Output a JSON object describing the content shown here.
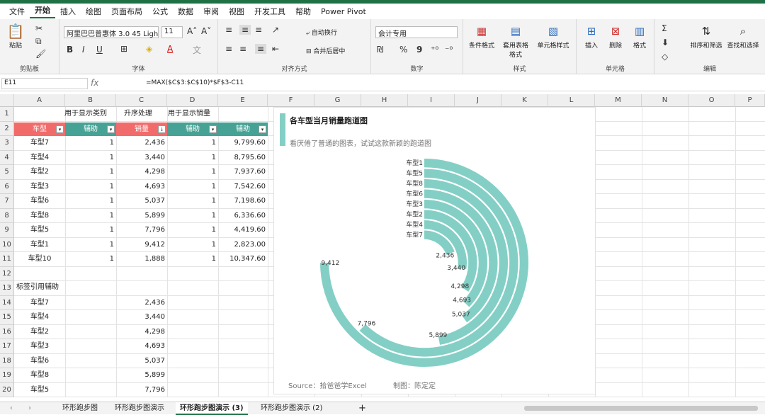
{
  "menu": [
    "文件",
    "开始",
    "插入",
    "绘图",
    "页面布局",
    "公式",
    "数据",
    "审阅",
    "视图",
    "开发工具",
    "帮助",
    "Power Pivot"
  ],
  "ribbon": {
    "clipboard": {
      "label": "剪贴板",
      "paste": "粘贴"
    },
    "font": {
      "label": "字体",
      "font_name": "阿里巴巴普惠体 3.0 45 Light",
      "font_size": "11",
      "bold": "B",
      "italic": "I",
      "underline": "U"
    },
    "align": {
      "label": "对齐方式",
      "wrap": "自动换行",
      "merge": "合并后居中"
    },
    "number": {
      "label": "数字",
      "format": "会计专用",
      "percent": "%",
      "comma": "9"
    },
    "styles": {
      "label": "样式",
      "cond": "条件格式",
      "table": "套用表格格式",
      "cell": "单元格样式"
    },
    "cells": {
      "label": "单元格",
      "insert": "插入",
      "delete": "删除",
      "format": "格式"
    },
    "edit": {
      "label": "编辑",
      "sort": "排序和筛选",
      "find": "查找和选择"
    }
  },
  "formula_bar": {
    "name_box": "E11",
    "fx": "fx",
    "formula": "=MAX($C$3:$C$10)*$F$3-C11"
  },
  "columns": [
    "A",
    "B",
    "C",
    "D",
    "E",
    "F",
    "G",
    "H",
    "I",
    "J",
    "K",
    "L",
    "M",
    "N",
    "O",
    "P"
  ],
  "rows": [
    "1",
    "2",
    "3",
    "4",
    "5",
    "6",
    "7",
    "8",
    "9",
    "10",
    "11",
    "12",
    "13",
    "14",
    "15",
    "16",
    "17",
    "18",
    "19",
    "20"
  ],
  "row1": {
    "b": "用于显示类别",
    "c": "升序处理",
    "d": "用于显示销量"
  },
  "headers": {
    "a": "车型",
    "b": "辅助",
    "c": "销量",
    "d": "辅助",
    "e": "辅助"
  },
  "table": [
    {
      "a": "车型7",
      "b": "1",
      "c": "2,436",
      "d": "1",
      "e": "9,799.60"
    },
    {
      "a": "车型4",
      "b": "1",
      "c": "3,440",
      "d": "1",
      "e": "8,795.60"
    },
    {
      "a": "车型2",
      "b": "1",
      "c": "4,298",
      "d": "1",
      "e": "7,937.60"
    },
    {
      "a": "车型3",
      "b": "1",
      "c": "4,693",
      "d": "1",
      "e": "7,542.60"
    },
    {
      "a": "车型6",
      "b": "1",
      "c": "5,037",
      "d": "1",
      "e": "7,198.60"
    },
    {
      "a": "车型8",
      "b": "1",
      "c": "5,899",
      "d": "1",
      "e": "6,336.60"
    },
    {
      "a": "车型5",
      "b": "1",
      "c": "7,796",
      "d": "1",
      "e": "4,419.60"
    },
    {
      "a": "车型1",
      "b": "1",
      "c": "9,412",
      "d": "1",
      "e": "2,823.00"
    },
    {
      "a": "车型10",
      "b": "1",
      "c": "1,888",
      "d": "1",
      "e": "10,347.60"
    }
  ],
  "label_helper_title": "标签引用辅助",
  "label_helper": [
    {
      "a": "车型7",
      "c": "2,436"
    },
    {
      "a": "车型4",
      "c": "3,440"
    },
    {
      "a": "车型2",
      "c": "4,298"
    },
    {
      "a": "车型3",
      "c": "4,693"
    },
    {
      "a": "车型6",
      "c": "5,037"
    },
    {
      "a": "车型8",
      "c": "5,899"
    },
    {
      "a": "车型5",
      "c": "7,796"
    }
  ],
  "chart": {
    "title": "各车型当月销量跑道图",
    "subtitle": "看厌倦了普通的图表，试试这款新颖的跑道图",
    "source": "Source：拾爸爸学Excel",
    "author": "制图：陈定定"
  },
  "chart_data": {
    "type": "radial-bar",
    "categories": [
      "车型1",
      "车型5",
      "车型8",
      "车型6",
      "车型3",
      "车型2",
      "车型4",
      "车型7"
    ],
    "values": [
      9412,
      7796,
      5899,
      5037,
      4693,
      4298,
      3440,
      2436
    ],
    "value_labels": [
      "9,412",
      "7,796",
      "5,899",
      "5,037",
      "4,693",
      "4,298",
      "3,440",
      "2,436"
    ],
    "max": 9412,
    "color": "#84cfc5"
  },
  "sheet_tabs": [
    "环形跑步图",
    "环形跑步图演示",
    "环形跑步图演示 (3)",
    "环形跑步图演示 (2)"
  ],
  "active_tab": 2,
  "colors": {
    "accent": "#1e7145",
    "header_red": "#f26b6b",
    "header_teal": "#46a295",
    "chart": "#84cfc5"
  }
}
